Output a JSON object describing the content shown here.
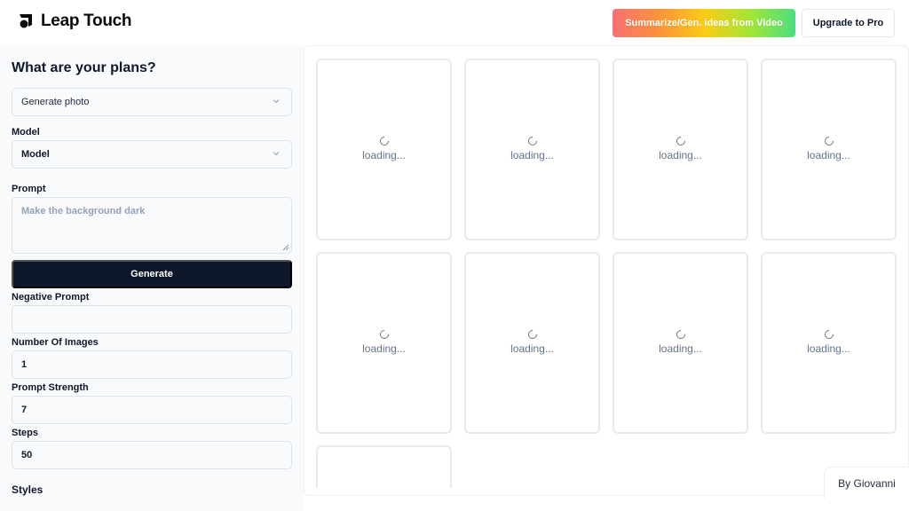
{
  "header": {
    "app_name": "Leap Touch",
    "logo_icon": "leap-logo-icon",
    "summarize_button": "Summarize/Gen. ideas from Video",
    "upgrade_button": "Upgrade to Pro",
    "summarize_gradient": [
      "#f87171",
      "#fb923c",
      "#facc15",
      "#a3e635",
      "#4ade80"
    ]
  },
  "sidebar": {
    "title": "What are your plans?",
    "plan_select": {
      "value": "Generate photo",
      "icon": "chevron-down-icon"
    },
    "model": {
      "label": "Model",
      "value": "Model",
      "icon": "chevron-down-icon"
    },
    "prompt": {
      "label": "Prompt",
      "placeholder": "Make the background dark",
      "value": ""
    },
    "generate_button": "Generate",
    "negative_prompt": {
      "label": "Negative Prompt",
      "value": ""
    },
    "number_of_images": {
      "label": "Number Of Images",
      "value": "1"
    },
    "prompt_strength": {
      "label": "Prompt Strength",
      "value": "7"
    },
    "steps": {
      "label": "Steps",
      "value": "50"
    },
    "styles_heading": "Styles"
  },
  "gallery": {
    "cards": [
      {
        "status": "loading...",
        "icon": "spinner-icon"
      },
      {
        "status": "loading...",
        "icon": "spinner-icon"
      },
      {
        "status": "loading...",
        "icon": "spinner-icon"
      },
      {
        "status": "loading...",
        "icon": "spinner-icon"
      },
      {
        "status": "loading...",
        "icon": "spinner-icon"
      },
      {
        "status": "loading...",
        "icon": "spinner-icon"
      },
      {
        "status": "loading...",
        "icon": "spinner-icon"
      },
      {
        "status": "loading...",
        "icon": "spinner-icon"
      },
      {
        "status": "",
        "icon": ""
      }
    ]
  },
  "footer": {
    "byline": "By Giovanni"
  },
  "colors": {
    "primary_dark": "#0f172a",
    "sidebar_bg": "#f8fafc",
    "muted_text": "#64748b"
  }
}
